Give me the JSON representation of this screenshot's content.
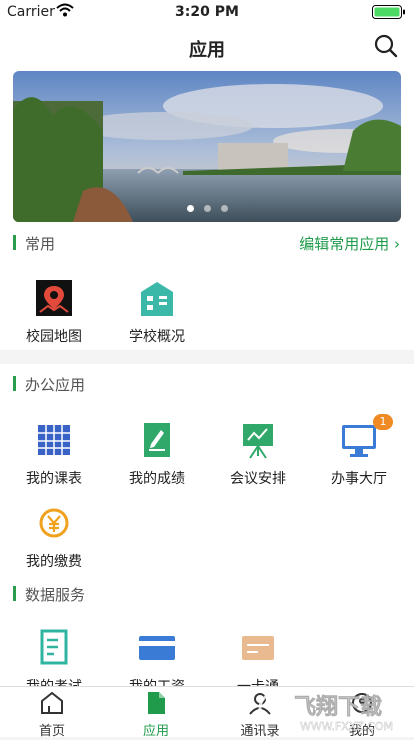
{
  "status": {
    "carrier": "Carrier",
    "time": "3:20 PM"
  },
  "nav": {
    "title": "应用"
  },
  "banner": {
    "dot_count": 3,
    "active_dot": 0
  },
  "frequent": {
    "title": "常用",
    "edit_label": "编辑常用应用",
    "items": [
      {
        "label": "校园地图",
        "icon": "campus-map-icon"
      },
      {
        "label": "学校概况",
        "icon": "school-overview-icon"
      }
    ]
  },
  "office": {
    "title": "办公应用",
    "items": [
      {
        "label": "我的课表",
        "icon": "schedule-icon"
      },
      {
        "label": "我的成绩",
        "icon": "grades-icon"
      },
      {
        "label": "会议安排",
        "icon": "meeting-icon"
      },
      {
        "label": "办事大厅",
        "icon": "service-hall-icon",
        "badge": "1"
      },
      {
        "label": "我的缴费",
        "icon": "payment-icon"
      }
    ]
  },
  "data_service": {
    "title": "数据服务",
    "items": [
      {
        "label": "我的考试",
        "icon": "exam-icon"
      },
      {
        "label": "我的工资",
        "icon": "salary-icon"
      },
      {
        "label": "一卡通",
        "icon": "card-icon"
      }
    ]
  },
  "tabs": [
    {
      "label": "首页",
      "icon": "home-icon"
    },
    {
      "label": "应用",
      "icon": "apps-icon",
      "active": true
    },
    {
      "label": "通讯录",
      "icon": "contacts-icon"
    },
    {
      "label": "我的",
      "icon": "profile-icon"
    }
  ],
  "watermark": {
    "text": "飞翔下载",
    "url": "WWW.FXXZ.COM"
  },
  "colors": {
    "accent": "#1f9b4b",
    "badge": "#f08a24"
  }
}
